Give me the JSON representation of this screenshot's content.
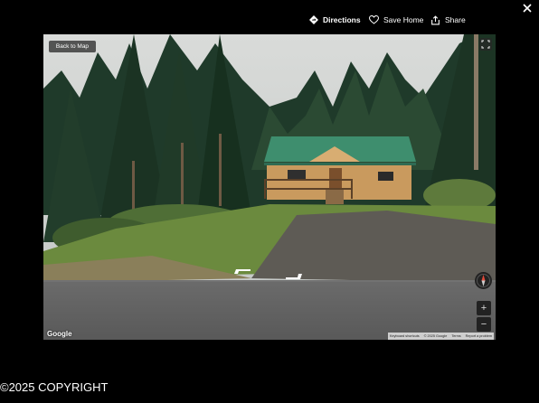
{
  "header": {
    "directions_label": "Directions",
    "save_home_label": "Save Home",
    "share_label": "Share"
  },
  "viewer": {
    "back_label": "Back to Map",
    "zoom_in_label": "+",
    "zoom_out_label": "−",
    "provider_logo": "Google",
    "attribution": {
      "shortcuts": "Keyboard shortcuts",
      "copyright": "© 2025 Google",
      "terms": "Terms",
      "report": "Report a problem"
    }
  },
  "footer": {
    "copyright": "©2025 COPYRIGHT"
  },
  "colors": {
    "roof": "#3e8e6e",
    "siding": "#c99a5e",
    "background": "#000000"
  }
}
